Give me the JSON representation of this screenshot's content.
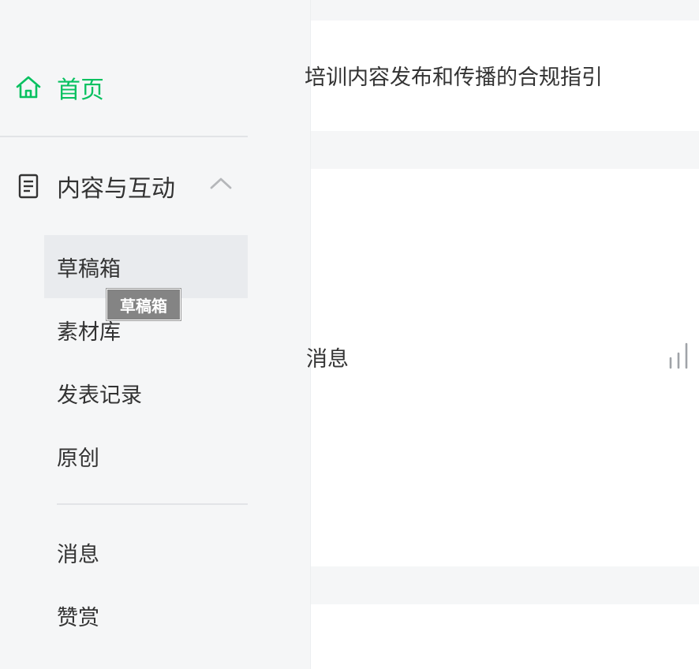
{
  "sidebar": {
    "home": {
      "label": "首页",
      "icon": "home-icon"
    },
    "group": {
      "label": "内容与互动",
      "icon": "document-icon",
      "expanded": true,
      "items": [
        {
          "label": "草稿箱",
          "active": true
        },
        {
          "label": "素材库"
        },
        {
          "label": "发表记录"
        },
        {
          "label": "原创"
        }
      ],
      "items2": [
        {
          "label": "消息"
        },
        {
          "label": "赞赏"
        }
      ]
    },
    "tooltip": "草稿箱"
  },
  "main": {
    "card1": {
      "text": "培训内容发布和传播的合规指引"
    },
    "card2": {
      "text": "消息",
      "icon": "chart-icon"
    }
  },
  "colors": {
    "accent": "#07c160",
    "sidebar_bg": "#f5f6f7",
    "active_bg": "#e9ebee",
    "text": "#333333"
  }
}
